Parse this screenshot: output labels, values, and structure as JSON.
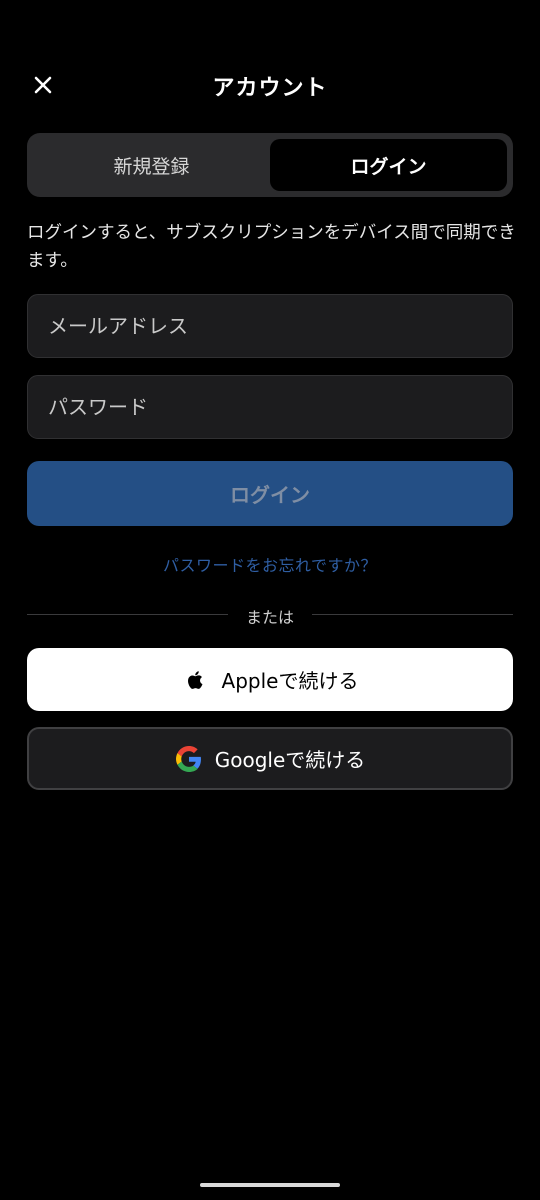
{
  "header": {
    "title": "アカウント"
  },
  "tabs": {
    "signup_label": "新規登録",
    "login_label": "ログイン",
    "selected": "login"
  },
  "description": "ログインすると、サブスクリプションをデバイス間で同期できます。",
  "form": {
    "email_placeholder": "メールアドレス",
    "email_value": "",
    "password_placeholder": "パスワード",
    "password_value": ""
  },
  "login_button_label": "ログイン",
  "forgot_password_label": "パスワードをお忘れですか？",
  "divider_label": "または",
  "social": {
    "apple_label": "Appleで続ける",
    "google_label": "Googleで続ける"
  },
  "icons": {
    "close": "close-icon",
    "apple": "apple-logo-icon",
    "google": "google-logo-icon"
  },
  "colors": {
    "background": "#000000",
    "primary_button": "#244f85",
    "link": "#2f5ea3",
    "field_background": "#1c1c1e"
  }
}
